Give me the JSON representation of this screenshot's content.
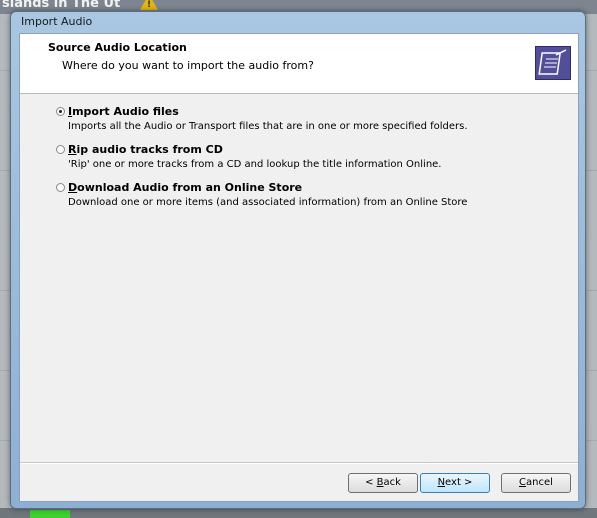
{
  "background_app": {
    "title_fragment": "slands in The Ut"
  },
  "window": {
    "title": "Import Audio"
  },
  "header": {
    "title": "Source Audio Location",
    "subtitle": "Where do you want to import the audio from?",
    "icon": "document-pen-icon"
  },
  "options": [
    {
      "label_mnemonic": "I",
      "label_rest": "mport Audio files",
      "description": "Imports all the Audio or Transport files that are in one or more specified folders.",
      "checked": true
    },
    {
      "label_mnemonic": "R",
      "label_rest": "ip audio tracks from CD",
      "description": "'Rip' one or more tracks from a CD and lookup the title information Online.",
      "checked": false
    },
    {
      "label_mnemonic": "D",
      "label_rest": "ownload Audio from an Online Store",
      "description": "Download one or more items (and associated information) from an Online Store",
      "checked": false
    }
  ],
  "buttons": {
    "back_pre": "< ",
    "back_mnemonic": "B",
    "back_rest": "ack",
    "next_mnemonic": "N",
    "next_rest": "ext >",
    "cancel_mnemonic": "C",
    "cancel_rest": "ancel"
  },
  "colors": {
    "header_icon": "#524e9a",
    "frame": "#a9c7e2"
  }
}
